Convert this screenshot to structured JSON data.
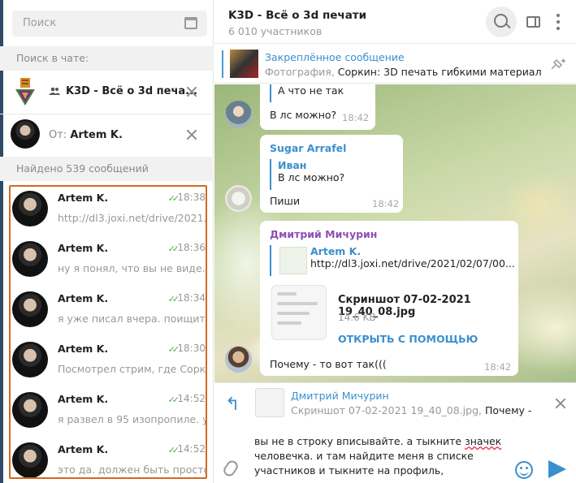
{
  "left": {
    "search_placeholder": "Поиск",
    "chat_search_label": "Поиск в чате:",
    "chat_filter_title": "K3D - Всё о 3d печа...",
    "from_prefix": "От:",
    "from_name": "Artem K.",
    "results_count": "Найдено 539 сообщений",
    "results": [
      {
        "name": "Artem K.",
        "time": "18:38",
        "text": "http://dl3.joxi.net/drive/2021..."
      },
      {
        "name": "Artem K.",
        "time": "18:36",
        "text": "ну я понял, что вы не виде..."
      },
      {
        "name": "Artem K.",
        "time": "18:34",
        "text": "я уже писал вчера. поищит..."
      },
      {
        "name": "Artem K.",
        "time": "18:30",
        "text": "Посмотрел стрим, где Сорк..."
      },
      {
        "name": "Artem K.",
        "time": "14:52",
        "text": "я развел в 95 изопропиле. у..."
      },
      {
        "name": "Artem K.",
        "time": "14:52",
        "text": "это да. должен быть просто..."
      }
    ]
  },
  "header": {
    "title": "K3D - Всё о 3d печати",
    "subtitle": "6 010 участников"
  },
  "pinned": {
    "title": "Закреплённое сообщение",
    "kind": "Фотография,",
    "text": " Соркин: 3D печать гибкими материал..."
  },
  "messages": {
    "m1": {
      "quote": "А что не так",
      "text": "В лс можно?",
      "time": "18:42"
    },
    "m2": {
      "name": "Sugar Arrafel",
      "quote_name": "Иван",
      "quote_text": "В лс можно?",
      "text": "Пиши",
      "time": "18:42"
    },
    "m3": {
      "name": "Дмитрий Мичурин",
      "quote_name": "Artem K.",
      "quote_text": "http://dl3.joxi.net/drive/2021/02/07/00...",
      "file_name": "Скриншот 07-02-2021 19_40_08.jpg",
      "file_size": "14.6 KB",
      "open_with": "ОТКРЫТЬ С ПОМОЩЬЮ",
      "text": "Почему - то вот так(((",
      "time": "18:42"
    }
  },
  "reply": {
    "name": "Дмитрий Мичурин",
    "kind": "Скриншот 07-02-2021 19_40_08.jpg,",
    "text": " Почему - то..."
  },
  "input": {
    "line1": "вы не в строку вписывайте. а тыкните ",
    "line1_err": "значек",
    "line2": "человечка. и там найдите меня в списке",
    "line3": "участников и тыкните на профиль,"
  },
  "colors": {
    "accent": "#3a8fce",
    "highlight": "#d2691e",
    "read_ticks": "#4fae4e",
    "sidebar_strip": "#2d4a66"
  }
}
